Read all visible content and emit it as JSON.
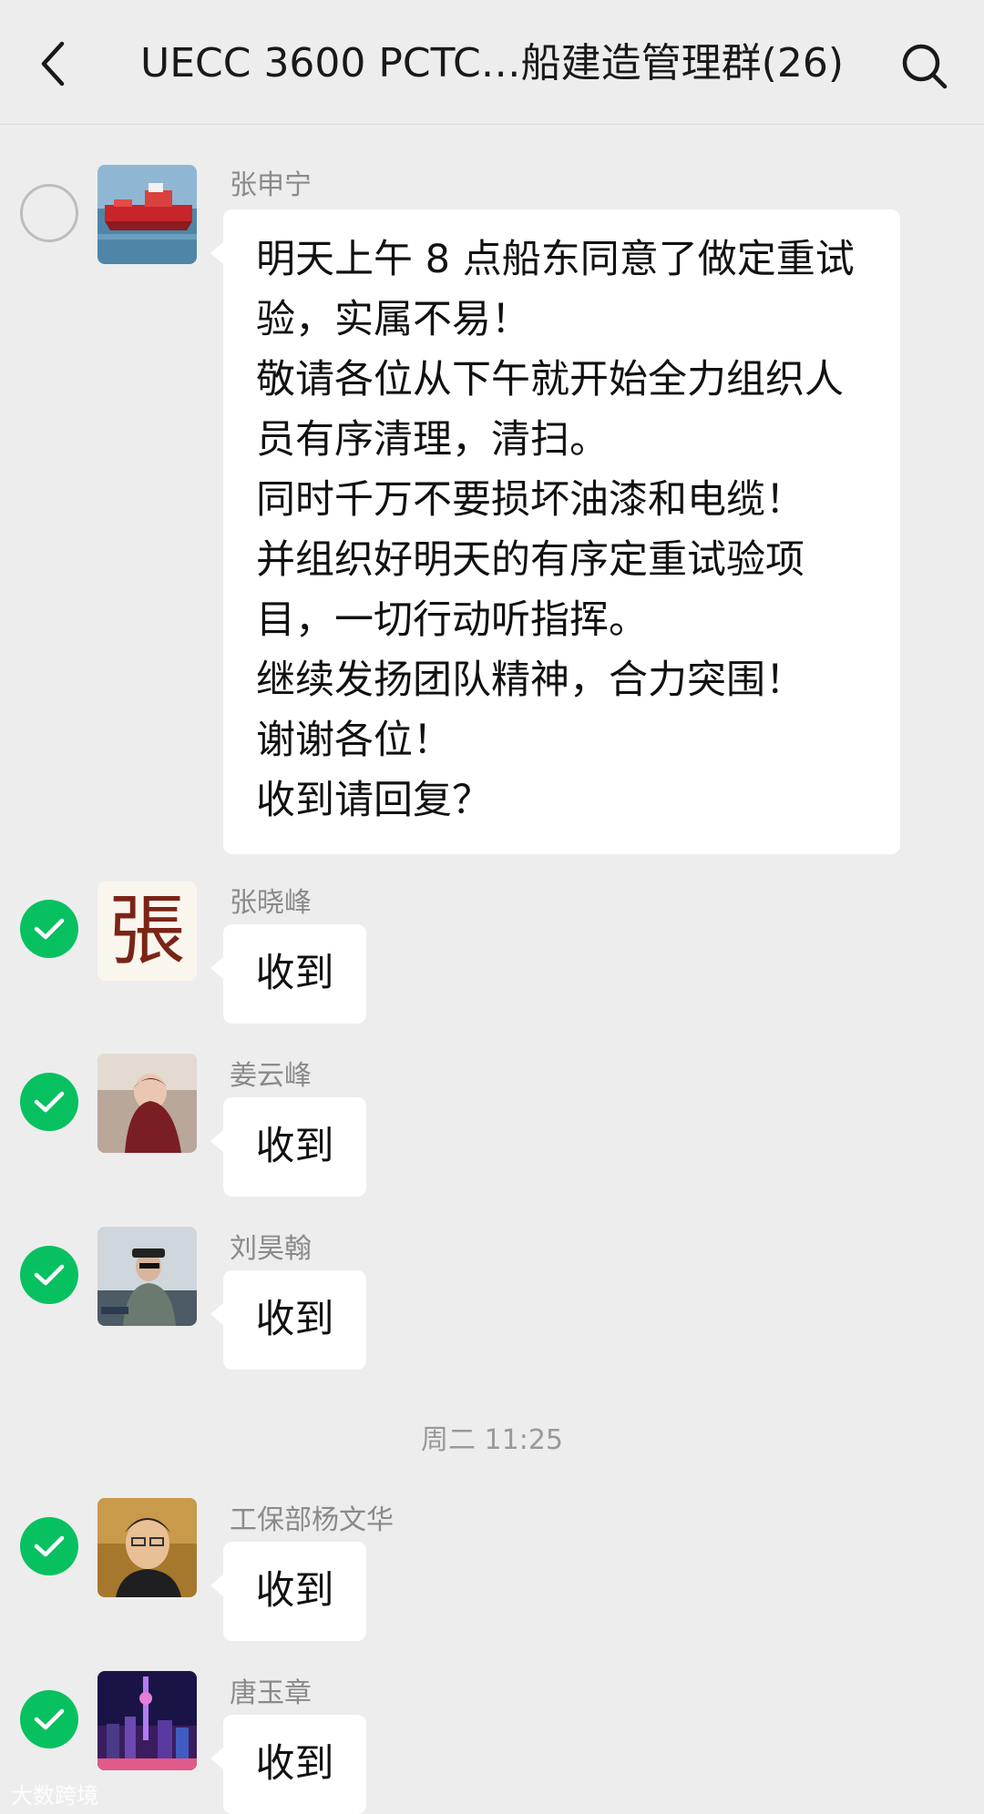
{
  "header": {
    "title": "UECC 3600 PCTC…船建造管理群(26)",
    "back_icon": "chevron-left-icon",
    "search_icon": "search-icon"
  },
  "messages": [
    {
      "sender": "张申宁",
      "lines": [
        "明天上午 8 点船东同意了做定重试",
        "验，实属不易！",
        "敬请各位从下午就开始全力组织人",
        "员有序清理，清扫。",
        "同时千万不要损坏油漆和电缆！",
        "并组织好明天的有序定重试验项",
        "目，一切行动听指挥。",
        "继续发扬团队精神，合力突围！",
        "谢谢各位！",
        "收到请回复？"
      ],
      "selected": false
    },
    {
      "sender": "张晓峰",
      "text": "收到",
      "selected": true,
      "avatar_glyph": "張"
    },
    {
      "sender": "姜云峰",
      "text": "收到",
      "selected": true
    },
    {
      "sender": "刘昊翰",
      "text": "收到",
      "selected": true
    },
    {
      "sender": "工保部杨文华",
      "text": "收到",
      "selected": true
    },
    {
      "sender": "唐玉章",
      "text": "收到",
      "selected": true
    }
  ],
  "time_separator": "周二 11:25",
  "watermark": "大数跨境",
  "colors": {
    "background": "#ededed",
    "bubble": "#ffffff",
    "check": "#07c160",
    "sender": "#8a8a8a"
  }
}
